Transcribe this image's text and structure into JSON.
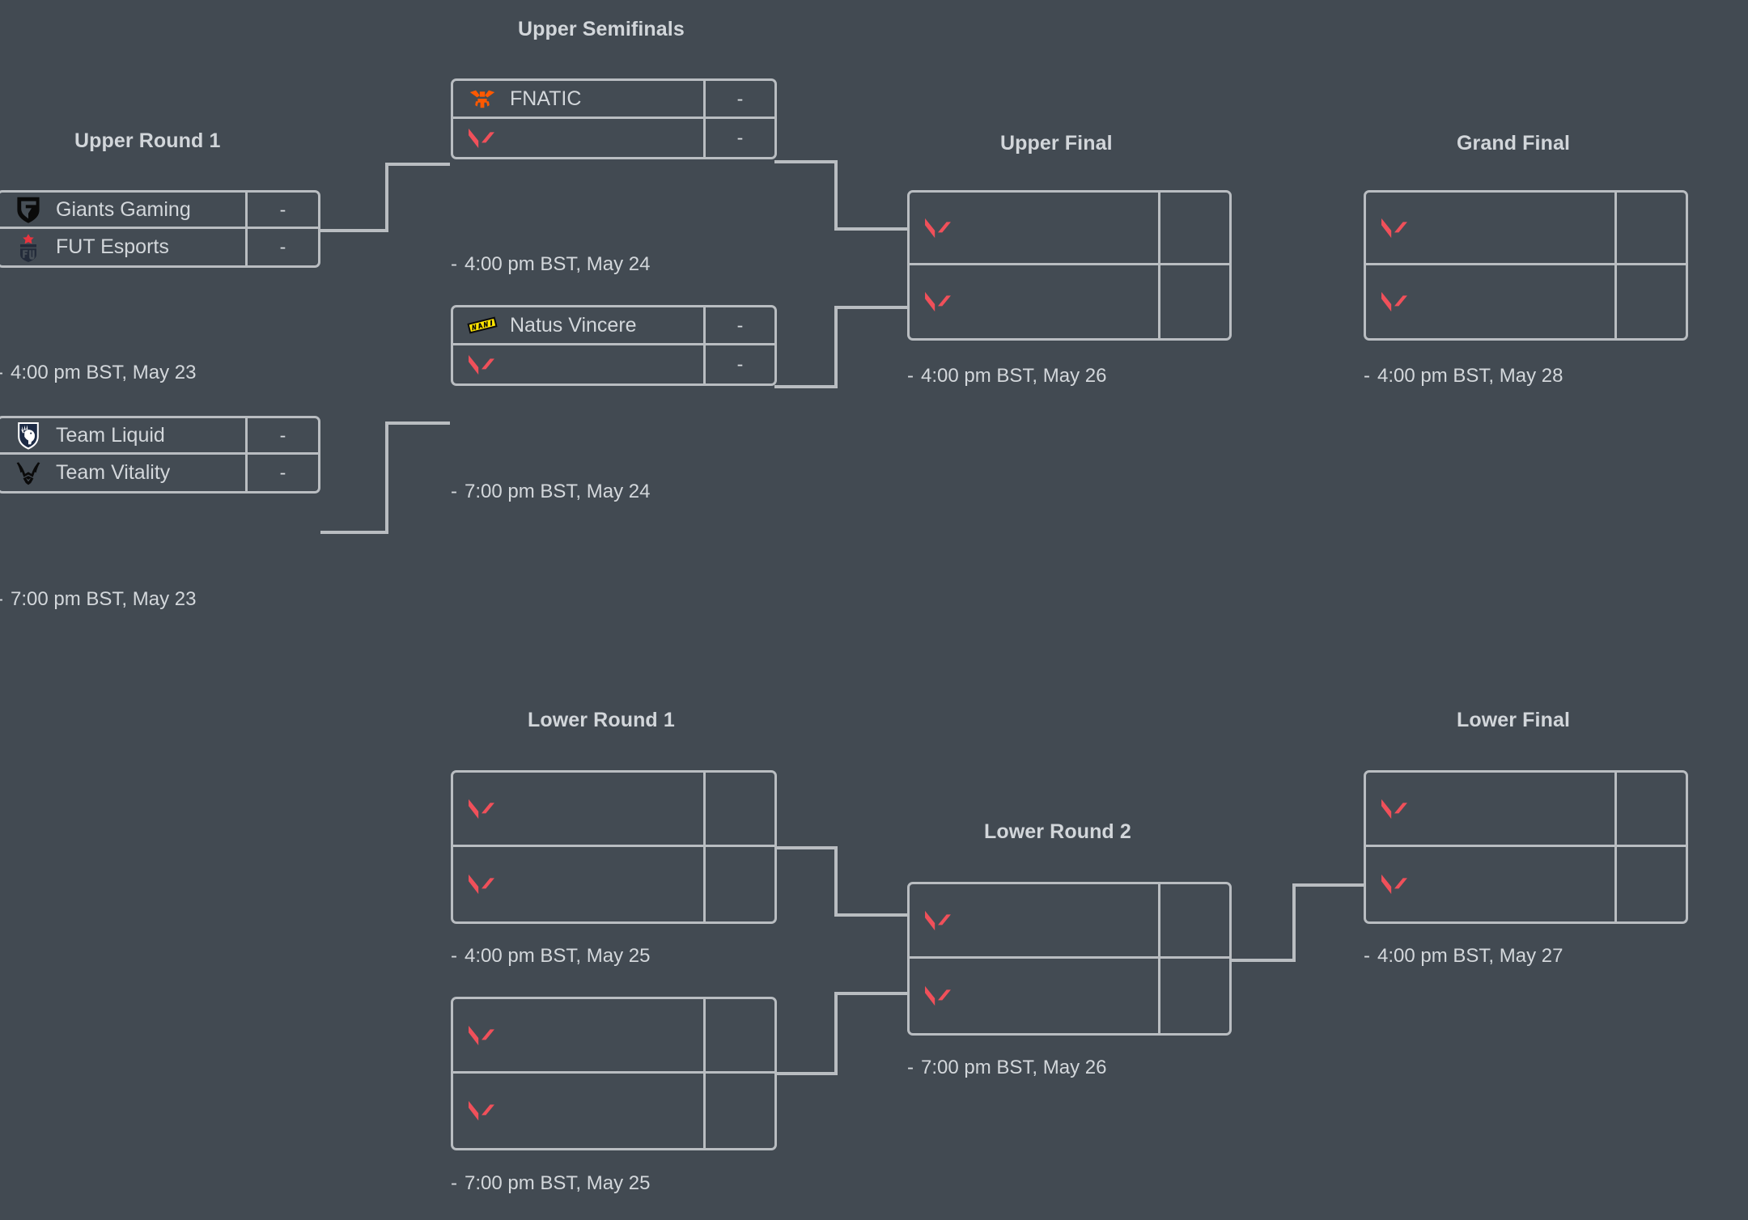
{
  "colors": {
    "background": "#424a52",
    "border": "#b9bdc1",
    "text": "#d3d7db",
    "heading": "#d2d6da",
    "valorant_red": "#f0505a",
    "fnatic_orange": "#ff5900",
    "navi_yellow": "#ffe500",
    "liquid_navy": "#1d2b45",
    "giants_black": "#0a0a0a",
    "fut_navy": "#232b3a",
    "fut_star_red": "#e8343f",
    "vitality_black": "#0a0a0a"
  },
  "placeholder_score": "-",
  "rounds": [
    {
      "id": "upper-round-1",
      "title": "Upper Round 1"
    },
    {
      "id": "upper-semifinals",
      "title": "Upper Semifinals"
    },
    {
      "id": "upper-final",
      "title": "Upper Final"
    },
    {
      "id": "grand-final",
      "title": "Grand Final"
    },
    {
      "id": "lower-round-1",
      "title": "Lower Round 1"
    },
    {
      "id": "lower-round-2",
      "title": "Lower Round 2"
    },
    {
      "id": "lower-final",
      "title": "Lower Final"
    }
  ],
  "matches": {
    "ur1_m1": {
      "date": "4:00 pm BST, May 23",
      "teams": [
        {
          "name": "Giants Gaming",
          "logo": "giants-gaming-logo",
          "score": "-"
        },
        {
          "name": "FUT Esports",
          "logo": "fut-esports-logo",
          "score": "-"
        }
      ]
    },
    "ur1_m2": {
      "date": "7:00 pm BST, May 23",
      "teams": [
        {
          "name": "Team Liquid",
          "logo": "team-liquid-logo",
          "score": "-"
        },
        {
          "name": "Team Vitality",
          "logo": "team-vitality-logo",
          "score": "-"
        }
      ]
    },
    "usf_m1": {
      "date": "4:00 pm BST, May 24",
      "teams": [
        {
          "name": "FNATIC",
          "logo": "fnatic-logo",
          "score": "-"
        },
        {
          "name": "",
          "logo": "valorant-placeholder-logo",
          "score": "-"
        }
      ]
    },
    "usf_m2": {
      "date": "7:00 pm BST, May 24",
      "teams": [
        {
          "name": "Natus Vincere",
          "logo": "navi-logo",
          "score": "-"
        },
        {
          "name": "",
          "logo": "valorant-placeholder-logo",
          "score": "-"
        }
      ]
    },
    "uf_m1": {
      "date": "4:00 pm BST, May 26",
      "teams": [
        {
          "name": "",
          "logo": "valorant-placeholder-logo",
          "score": ""
        },
        {
          "name": "",
          "logo": "valorant-placeholder-logo",
          "score": ""
        }
      ]
    },
    "gf_m1": {
      "date": "4:00 pm BST, May 28",
      "teams": [
        {
          "name": "",
          "logo": "valorant-placeholder-logo",
          "score": ""
        },
        {
          "name": "",
          "logo": "valorant-placeholder-logo",
          "score": ""
        }
      ]
    },
    "lr1_m1": {
      "date": "4:00 pm BST, May 25",
      "teams": [
        {
          "name": "",
          "logo": "valorant-placeholder-logo",
          "score": ""
        },
        {
          "name": "",
          "logo": "valorant-placeholder-logo",
          "score": ""
        }
      ]
    },
    "lr1_m2": {
      "date": "7:00 pm BST, May 25",
      "teams": [
        {
          "name": "",
          "logo": "valorant-placeholder-logo",
          "score": ""
        },
        {
          "name": "",
          "logo": "valorant-placeholder-logo",
          "score": ""
        }
      ]
    },
    "lr2_m1": {
      "date": "7:00 pm BST, May 26",
      "teams": [
        {
          "name": "",
          "logo": "valorant-placeholder-logo",
          "score": ""
        },
        {
          "name": "",
          "logo": "valorant-placeholder-logo",
          "score": ""
        }
      ]
    },
    "lf_m1": {
      "date": "4:00 pm BST, May 27",
      "teams": [
        {
          "name": "",
          "logo": "valorant-placeholder-logo",
          "score": ""
        },
        {
          "name": "",
          "logo": "valorant-placeholder-logo",
          "score": ""
        }
      ]
    }
  }
}
